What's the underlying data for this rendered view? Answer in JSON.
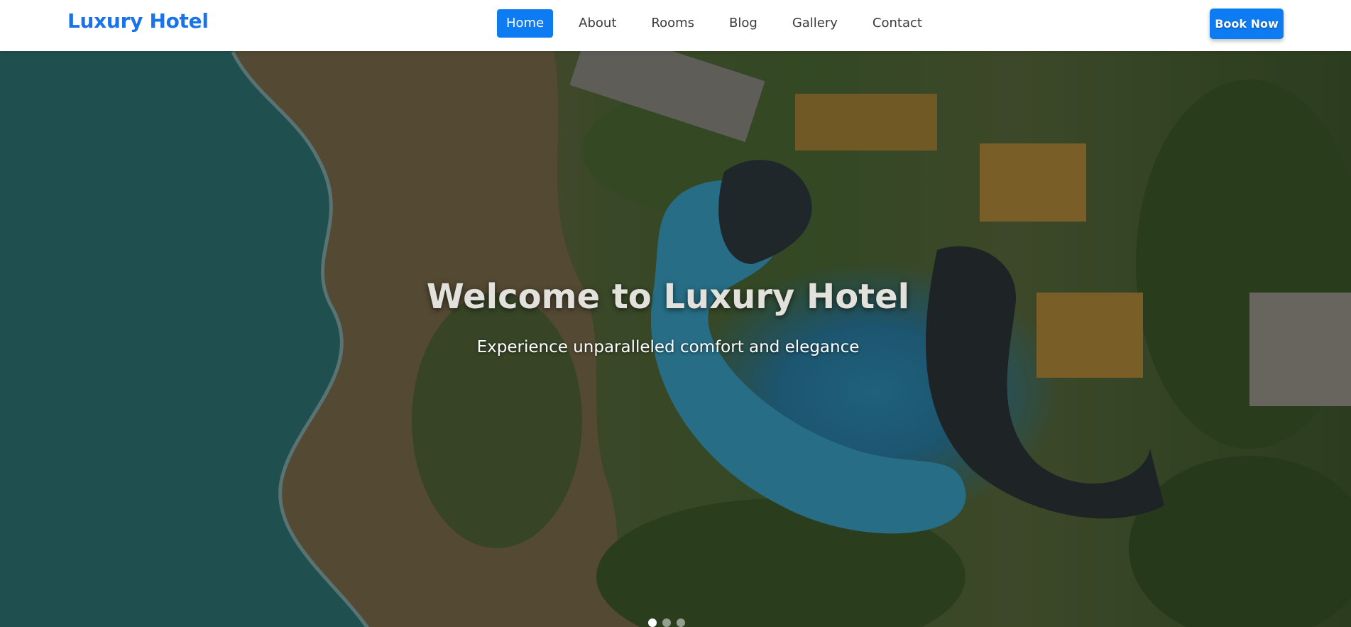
{
  "header": {
    "brand": "Luxury Hotel",
    "nav": [
      {
        "label": "Home",
        "active": true
      },
      {
        "label": "About",
        "active": false
      },
      {
        "label": "Rooms",
        "active": false
      },
      {
        "label": "Blog",
        "active": false
      },
      {
        "label": "Gallery",
        "active": false
      },
      {
        "label": "Contact",
        "active": false
      }
    ],
    "cta_label": "Book Now"
  },
  "hero": {
    "title": "Welcome to Luxury Hotel",
    "subtitle": "Experience unparalleled comfort and elegance",
    "image": "aerial-resort-photo",
    "slides": [
      {
        "active": true
      },
      {
        "active": false
      },
      {
        "active": false
      }
    ]
  },
  "colors": {
    "accent": "#0d7cf2",
    "brand_text": "#1a73e8",
    "nav_text": "#3a3a3a"
  }
}
